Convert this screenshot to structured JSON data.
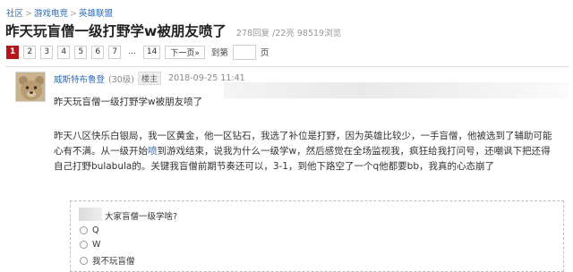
{
  "breadcrumb": {
    "items": [
      "社区",
      "游戏电竞",
      "英雄联盟"
    ],
    "separator": ">"
  },
  "thread": {
    "title": "昨天玩盲僧一级打野学w被朋友喷了",
    "stats": "278回复 /22亮  98519浏览"
  },
  "pager": {
    "pages": [
      "1",
      "2",
      "3",
      "4",
      "5",
      "6",
      "7"
    ],
    "ellipsis": "...",
    "last": "14",
    "next": "下一页»",
    "jump_label": "到第",
    "jump_value": "",
    "unit": "页",
    "active_color": "#b4161b"
  },
  "post": {
    "username": "威斯特布鲁登",
    "level": "(30级)",
    "badge": "楼主",
    "time": "2018-09-25 11:41",
    "title": "昨天玩盲僧一级打野学w被朋友喷了",
    "body_1": "昨天八区快乐白银局，我一区黄金，他一区钻石，我选了补位是打野，因为英雄比较少，一手盲僧，他被选到了辅助可能心有不满。从一级开始",
    "body_highlight": "喷",
    "body_2": "到游戏结束，说我为什么一级学w，然后感觉在全场监视我，疯狂给我打问号，还嘲讽下把还得自己打野bulabula的。关键我盲僧前期节奏还可以，3-1，到他下路空了一个q他都要bb，我真的心态崩了"
  },
  "poll": {
    "question": "大家盲僧一级学啥?",
    "options": [
      "Q",
      "W",
      "我不玩盲僧"
    ]
  }
}
